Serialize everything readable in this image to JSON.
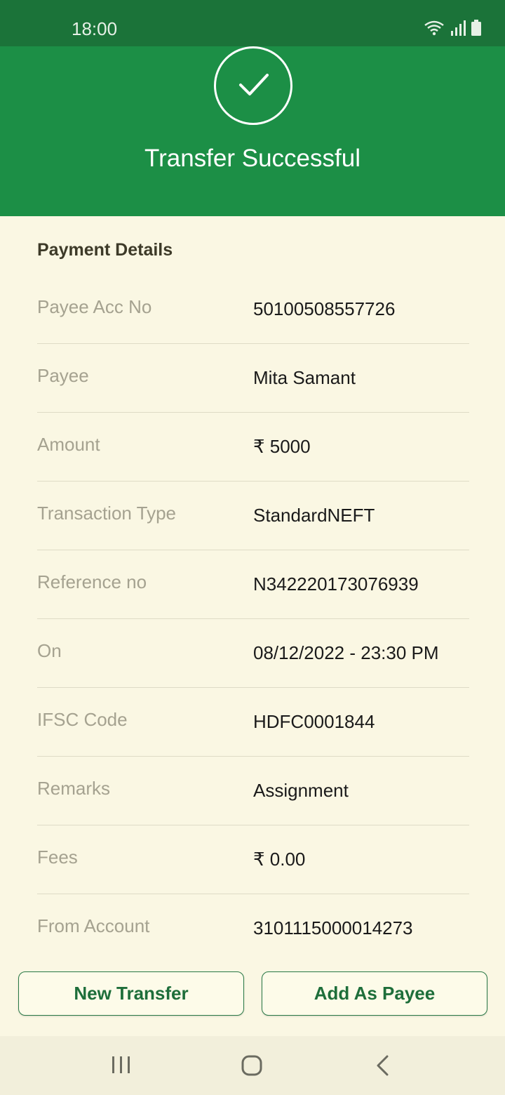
{
  "status_bar": {
    "time": "18:00"
  },
  "header": {
    "title": "Transfer Successful"
  },
  "details": {
    "section_title": "Payment Details",
    "rows": [
      {
        "label": "Payee Acc No",
        "value": "50100508557726"
      },
      {
        "label": "Payee",
        "value": "Mita Samant"
      },
      {
        "label": "Amount",
        "value": "₹ 5000"
      },
      {
        "label": "Transaction Type",
        "value": "StandardNEFT"
      },
      {
        "label": "Reference no",
        "value": "N342220173076939"
      },
      {
        "label": "On",
        "value": "08/12/2022 - 23:30 PM"
      },
      {
        "label": "IFSC Code",
        "value": "HDFC0001844"
      },
      {
        "label": "Remarks",
        "value": "Assignment"
      },
      {
        "label": "Fees",
        "value": "₹ 0.00"
      },
      {
        "label": "From Account",
        "value": "3101115000014273"
      }
    ]
  },
  "buttons": {
    "new_transfer": "New Transfer",
    "add_payee": "Add As Payee"
  },
  "icons": {
    "status": [
      "wifi-icon",
      "signal-icon",
      "battery-icon"
    ],
    "header": "checkmark-icon",
    "nav": [
      "recent-apps-icon",
      "home-icon",
      "back-icon"
    ]
  },
  "colors": {
    "header_green": "#1c8f46",
    "status_green": "#1b7339",
    "background": "#faf7e3",
    "button_text": "#1e6e3a"
  }
}
